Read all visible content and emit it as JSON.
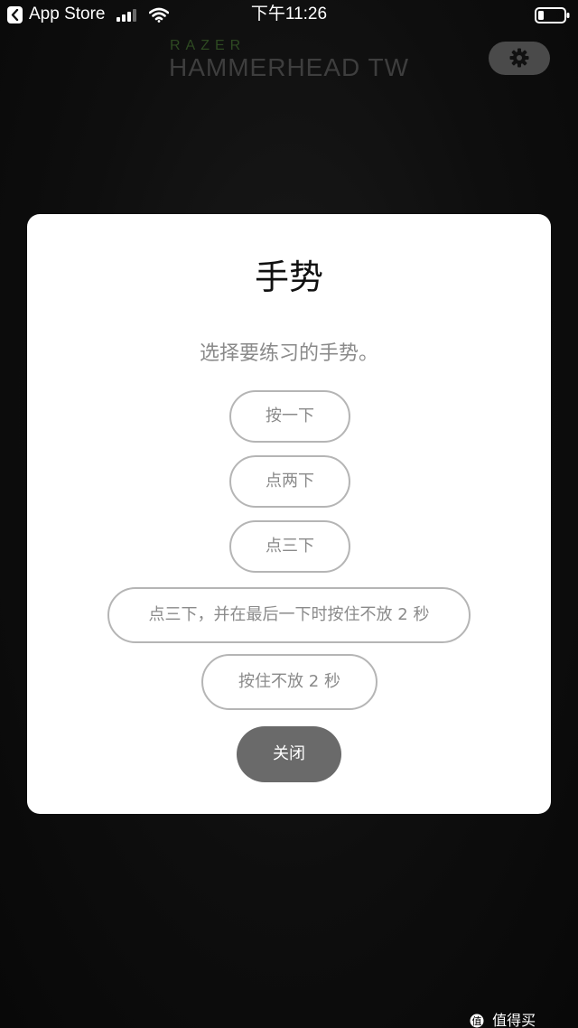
{
  "status_bar": {
    "back_app": "App Store",
    "time": "下午11:26"
  },
  "header": {
    "brand": "RAZER",
    "product": "HAMMERHEAD TW"
  },
  "modal": {
    "title": "手势",
    "subtitle": "选择要练习的手势。",
    "options": [
      "按一下",
      "点两下",
      "点三下",
      "点三下，并在最后一下时按住不放 2 秒",
      "按住不放 2 秒"
    ],
    "close_label": "关闭"
  },
  "watermark": {
    "text": "值得买"
  },
  "icons": {
    "back": "chevron-left-icon",
    "signal": "cellular-signal-icon",
    "wifi": "wifi-icon",
    "battery": "battery-icon",
    "settings": "gear-icon",
    "watermark": "site-logo-icon"
  },
  "colors": {
    "background": "#0b0b0b",
    "modal": "#ffffff",
    "option_border": "#b5b5b5",
    "option_text": "#8a8a8a",
    "close_button": "#6a6a6a",
    "settings_button": "#4a4a4a"
  }
}
